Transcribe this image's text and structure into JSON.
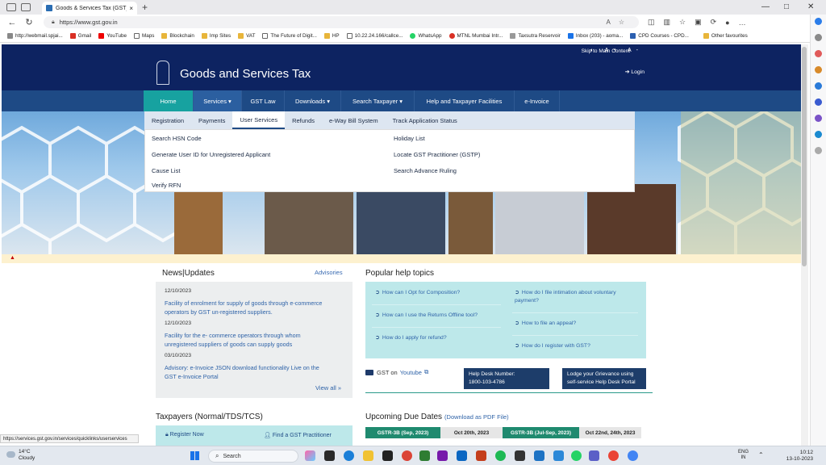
{
  "browser": {
    "tab_title": "Goods & Services Tax (GST) | Hon",
    "tab_close": "×",
    "new_tab": "+",
    "url": "https://www.gst.gov.in",
    "bookmarks": [
      "http://webmail.spjai...",
      "Gmail",
      "YouTube",
      "Maps",
      "Blockchain",
      "Imp Sites",
      "VAT",
      "The Future of Digit...",
      "HP",
      "10.22.24.166/callce...",
      "WhatsApp",
      "MTNL Mumbai Intr...",
      "Taxsutra Reservoir",
      "Inbox (203) - aoma...",
      "CPD Courses - CPD..."
    ],
    "other_favourites": "Other favourites",
    "status_url": "https://services.gst.gov.in/services/quicklinks/userservices"
  },
  "site": {
    "skip": "Skip to Main Content",
    "a11y": "◐ A+ A-",
    "title": "Goods and Services Tax",
    "login": "Login",
    "nav": [
      "Home",
      "Services ▾",
      "GST Law",
      "Downloads ▾",
      "Search Taxpayer ▾",
      "Help and Taxpayer Facilities",
      "e-Invoice"
    ],
    "subnav": [
      "Registration",
      "Payments",
      "User Services",
      "Refunds",
      "e-Way Bill System",
      "Track Application Status"
    ],
    "dropdown": {
      "left": [
        "Search HSN Code",
        "Generate User ID for Unregistered Applicant",
        "Cause List",
        "Verify RFN"
      ],
      "right": [
        "Holiday List",
        "Locate GST Practitioner (GSTP)",
        "Search Advance Ruling"
      ]
    },
    "news": {
      "title": "News|Updates",
      "advisories": "Advisories",
      "items": [
        {
          "date": "12/10/2023",
          "text": "Facility of enrolment for supply of goods through e-commerce operators by GST un-registered suppliers."
        },
        {
          "date": "12/10/2023",
          "text": "Facility for the e- commerce operators through whom unregistered suppliers of goods can supply goods"
        },
        {
          "date": "03/10/2023",
          "text": "Advisory: e-Invoice JSON download functionality Live on the GST e-Invoice Portal"
        }
      ],
      "view_all": "View all »"
    },
    "help": {
      "title": "Popular help topics",
      "left": [
        "How can I Opt for Composition?",
        "How can I use the Returns Offline tool?",
        "How do I apply for refund?"
      ],
      "right": [
        "How do I file intimation about voluntary payment?",
        "How to file an appeal?",
        "How do I register with GST?"
      ]
    },
    "youtube": {
      "prefix": "GST on",
      "link": "Youtube"
    },
    "helpdesk": {
      "label": "Help Desk Number:",
      "number": "1800-103-4786"
    },
    "grievance": "Lodge your Grievance using self-service Help Desk Portal",
    "taxpayers": {
      "title": "Taxpayers (Normal/TDS/TCS)",
      "register": "Register Now",
      "find": "Find a GST Practitioner"
    },
    "due": {
      "title": "Upcoming Due Dates",
      "pdf": "(Download as PDF File)",
      "cells": [
        "GSTR-3B (Sep, 2023)",
        "Oct 20th, 2023",
        "GSTR-3B (Jul-Sep, 2023)",
        "Oct 22nd, 24th, 2023"
      ]
    }
  },
  "taskbar": {
    "temp": "14°C",
    "weather": "Cloudy",
    "search": "Search",
    "lang1": "ENG",
    "lang2": "IN",
    "time": "10:12",
    "date": "13-10-2023"
  },
  "colors": {
    "header": "#0d2361",
    "nav": "#1e4a85",
    "home_tab": "#17a2a0",
    "help_bg": "#bde8ea",
    "due_green": "#1f8a6f"
  }
}
